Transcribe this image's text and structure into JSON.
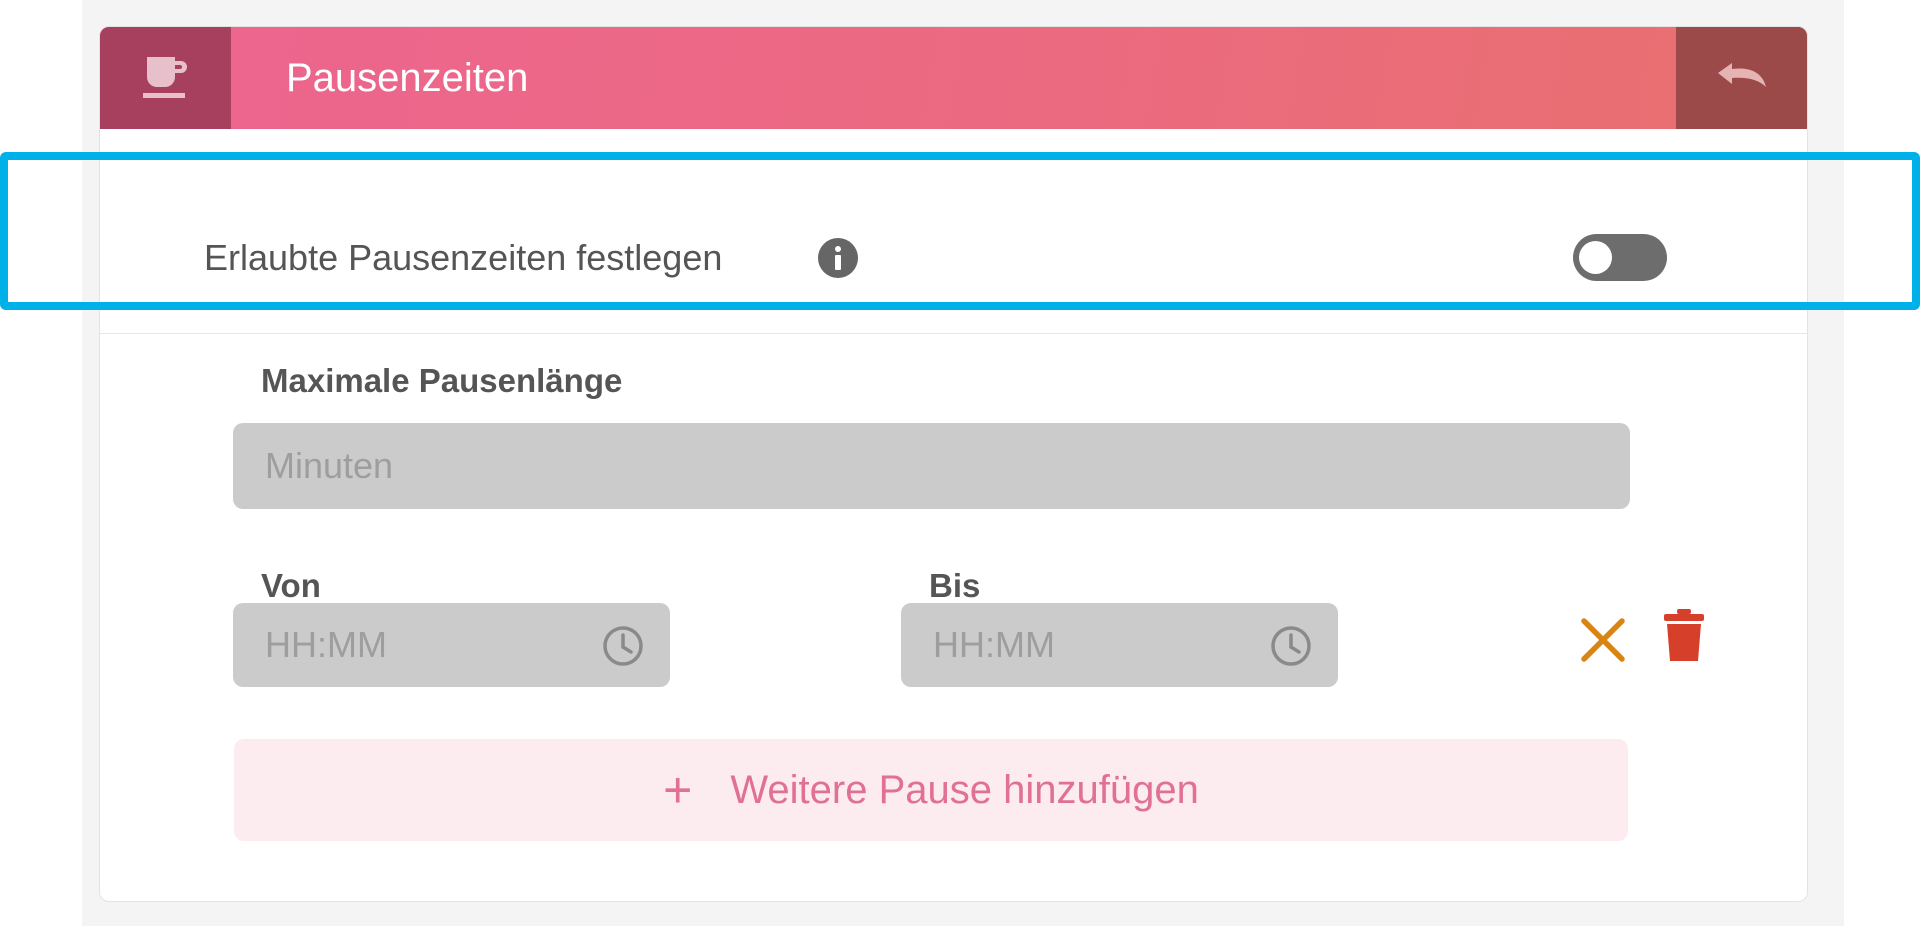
{
  "header": {
    "title": "Pausenzeiten",
    "icon": "coffee-cup-icon",
    "undo_icon": "undo-icon"
  },
  "toggle_row": {
    "label": "Erlaubte Pausenzeiten festlegen",
    "info_icon": "info-icon",
    "enabled": false
  },
  "max_pause": {
    "label": "Maximale Pausenlänge",
    "placeholder": "Minuten",
    "value": ""
  },
  "pause_entry": {
    "from_label": "Von",
    "from_placeholder": "HH:MM",
    "to_label": "Bis",
    "to_placeholder": "HH:MM"
  },
  "actions": {
    "clear_icon": "close-icon",
    "delete_icon": "trash-icon"
  },
  "add_button": {
    "plus": "+",
    "label": "Weitere Pause hinzufügen"
  },
  "colors": {
    "header_gradient_start": "#ec6590",
    "header_gradient_end": "#e8706f",
    "accent": "#e07096",
    "highlight": "#00b0e8",
    "clear_icon": "#d98513",
    "delete_icon": "#d6402b"
  }
}
